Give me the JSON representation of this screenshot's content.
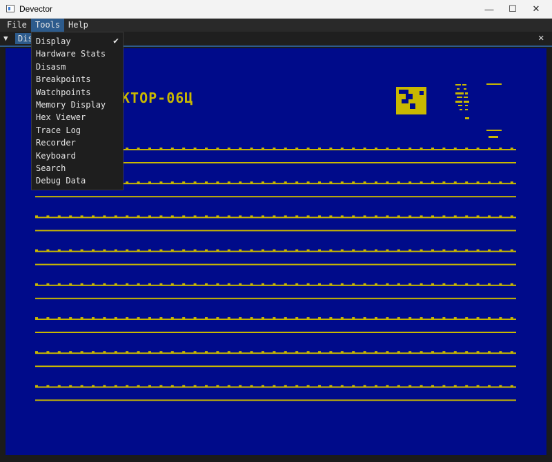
{
  "window": {
    "title": "Devector",
    "icons": {
      "app": "app-icon",
      "minimize": "minimize-icon",
      "maximize": "maximize-icon",
      "close": "close-icon"
    }
  },
  "menubar": {
    "items": [
      "File",
      "Tools",
      "Help"
    ],
    "active": "Tools"
  },
  "tabbar": {
    "active_tab_label": "Display",
    "active_tab_visible": "Dis",
    "collapse_icon": "triangle-down-icon",
    "close_icon": "close-icon"
  },
  "tools_menu": {
    "items": [
      {
        "label": "Display",
        "checked": true
      },
      {
        "label": "Hardware Stats",
        "checked": false
      },
      {
        "label": "Disasm",
        "checked": false
      },
      {
        "label": "Breakpoints",
        "checked": false
      },
      {
        "label": "Watchpoints",
        "checked": false
      },
      {
        "label": "Memory Display",
        "checked": false
      },
      {
        "label": "Hex Viewer",
        "checked": false
      },
      {
        "label": "Trace Log",
        "checked": false
      },
      {
        "label": "Recorder",
        "checked": false
      },
      {
        "label": "Keyboard",
        "checked": false
      },
      {
        "label": "Search",
        "checked": false
      },
      {
        "label": "Debug Data",
        "checked": false
      }
    ],
    "check_icon": "checkmark-icon"
  },
  "display": {
    "visible_title": "КТОР-06Ц",
    "colors": {
      "background": "#000b8a",
      "foreground": "#c9b800"
    }
  }
}
